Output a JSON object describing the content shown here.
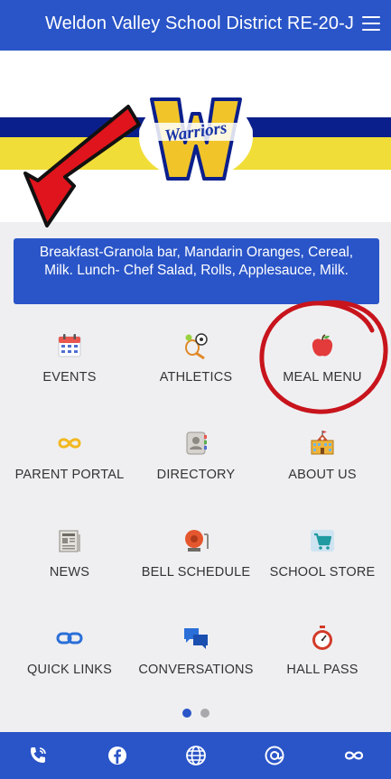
{
  "header": {
    "title": "Weldon Valley School District RE-20-J"
  },
  "banner": {
    "logo_text": "Warriors"
  },
  "announcement": {
    "text": "Breakfast-Granola bar, Mandarin Oranges, Cereal, Milk. Lunch- Chef Salad, Rolls, Applesauce, Milk."
  },
  "tiles": [
    {
      "label": "EVENTS",
      "icon": "calendar-icon"
    },
    {
      "label": "ATHLETICS",
      "icon": "sports-icon"
    },
    {
      "label": "MEAL MENU",
      "icon": "apple-icon"
    },
    {
      "label": "PARENT PORTAL",
      "icon": "infinity-icon"
    },
    {
      "label": "DIRECTORY",
      "icon": "contact-card-icon"
    },
    {
      "label": "ABOUT US",
      "icon": "school-icon"
    },
    {
      "label": "NEWS",
      "icon": "newspaper-icon"
    },
    {
      "label": "BELL SCHEDULE",
      "icon": "bell-icon"
    },
    {
      "label": "SCHOOL STORE",
      "icon": "shopping-cart-icon"
    },
    {
      "label": "QUICK LINKS",
      "icon": "link-icon"
    },
    {
      "label": "CONVERSATIONS",
      "icon": "chat-bubbles-icon"
    },
    {
      "label": "HALL PASS",
      "icon": "stopwatch-icon"
    }
  ],
  "pagination": {
    "current_page": 1,
    "total_pages": 2
  },
  "bottom_bar": [
    {
      "icon": "phone-icon"
    },
    {
      "icon": "facebook-icon"
    },
    {
      "icon": "globe-icon"
    },
    {
      "icon": "email-at-icon"
    },
    {
      "icon": "infinity-icon"
    }
  ],
  "colors": {
    "primary": "#2a55c8",
    "background": "#efeff1",
    "stripe_blue": "#0b1f8c",
    "stripe_yellow": "#f1dd37",
    "annotation_red": "#e0141c"
  }
}
